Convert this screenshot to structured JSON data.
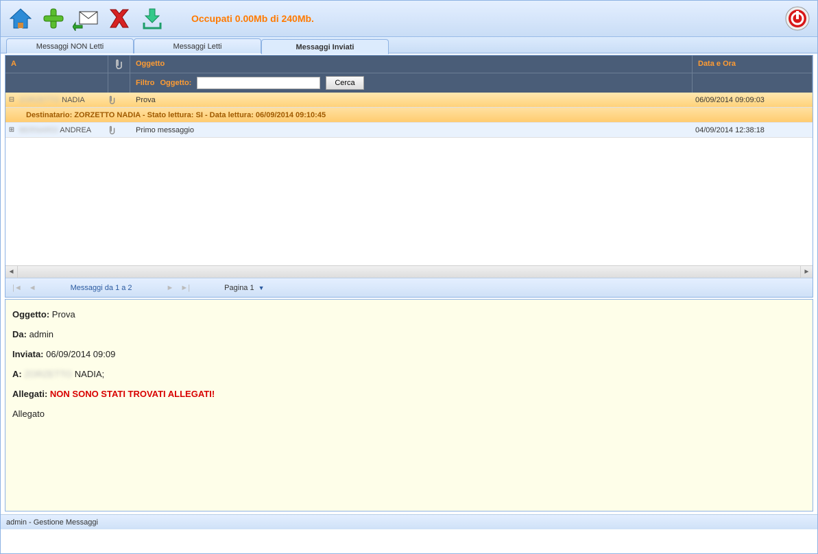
{
  "toolbar": {
    "status": "Occupati 0.00Mb di 240Mb."
  },
  "tabs": {
    "unread": "Messaggi NON Letti",
    "read": "Messaggi Letti",
    "sent": "Messaggi Inviati"
  },
  "grid": {
    "headers": {
      "a": "A",
      "oggetto": "Oggetto",
      "data": "Data e Ora",
      "filtro": "Filtro",
      "oggetto_label": "Oggetto:",
      "cerca": "Cerca"
    },
    "rows": [
      {
        "expand": "⊟",
        "a_blur": "ZORZETTO",
        "a_name": "NADIA",
        "oggetto": "Prova",
        "data": "06/09/2014 09:09:03",
        "selected": true,
        "detail": "Destinatario: ZORZETTO NADIA - Stato lettura: SI - Data lettura: 06/09/2014 09:10:45"
      },
      {
        "expand": "⊞",
        "a_blur": "BERNARDI",
        "a_name": "ANDREA",
        "oggetto": "Primo messaggio",
        "data": "04/09/2014 12:38:18",
        "selected": false
      }
    ]
  },
  "pager": {
    "info": "Messaggi da 1 a 2",
    "page_label": "Pagina 1"
  },
  "preview": {
    "oggetto_label": "Oggetto:",
    "oggetto_value": " Prova",
    "da_label": "Da:",
    "da_value": " admin",
    "inviata_label": "Inviata:",
    "inviata_value": " 06/09/2014 09:09",
    "a_label": "A:",
    "a_blur": "ZORZETTO",
    "a_value": " NADIA;",
    "allegati_label": "Allegati:",
    "allegati_value": " NON SONO STATI TROVATI ALLEGATI!",
    "allegato_text": "Allegato"
  },
  "statusbar": {
    "text": "admin - Gestione Messaggi"
  }
}
